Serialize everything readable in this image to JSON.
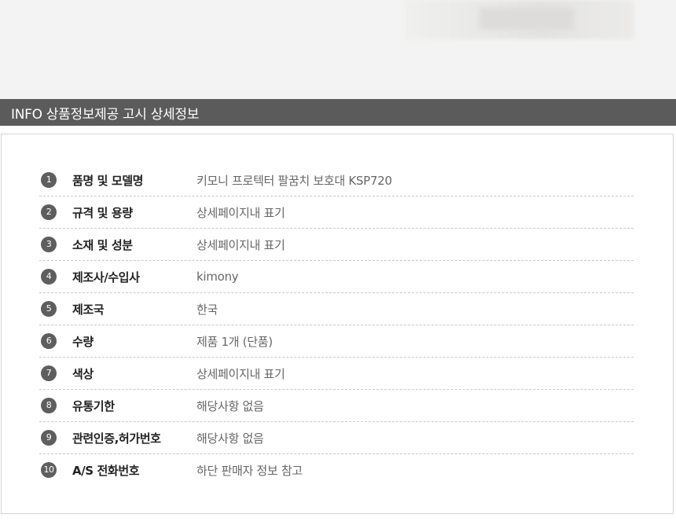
{
  "header": {
    "title": "INFO 상품정보제공 고시 상세정보"
  },
  "info": {
    "rows": [
      {
        "num": "1",
        "label": "품명 및 모델명",
        "value": "키모니 프로텍터 팔꿈치 보호대 KSP720"
      },
      {
        "num": "2",
        "label": "규격 및 용량",
        "value": "상세페이지내 표기"
      },
      {
        "num": "3",
        "label": "소재 및 성분",
        "value": "상세페이지내 표기"
      },
      {
        "num": "4",
        "label": "제조사/수입사",
        "value": "kimony"
      },
      {
        "num": "5",
        "label": "제조국",
        "value": "한국"
      },
      {
        "num": "6",
        "label": "수량",
        "value": "제품 1개 (단품)"
      },
      {
        "num": "7",
        "label": "색상",
        "value": "상세페이지내 표기"
      },
      {
        "num": "8",
        "label": "유통기한",
        "value": "해당사항 없음"
      },
      {
        "num": "9",
        "label": "관련인증,허가번호",
        "value": "해당사항 없음"
      },
      {
        "num": "10",
        "label": "A/S 전화번호",
        "value": "하단 판매자 정보 참고"
      }
    ]
  }
}
